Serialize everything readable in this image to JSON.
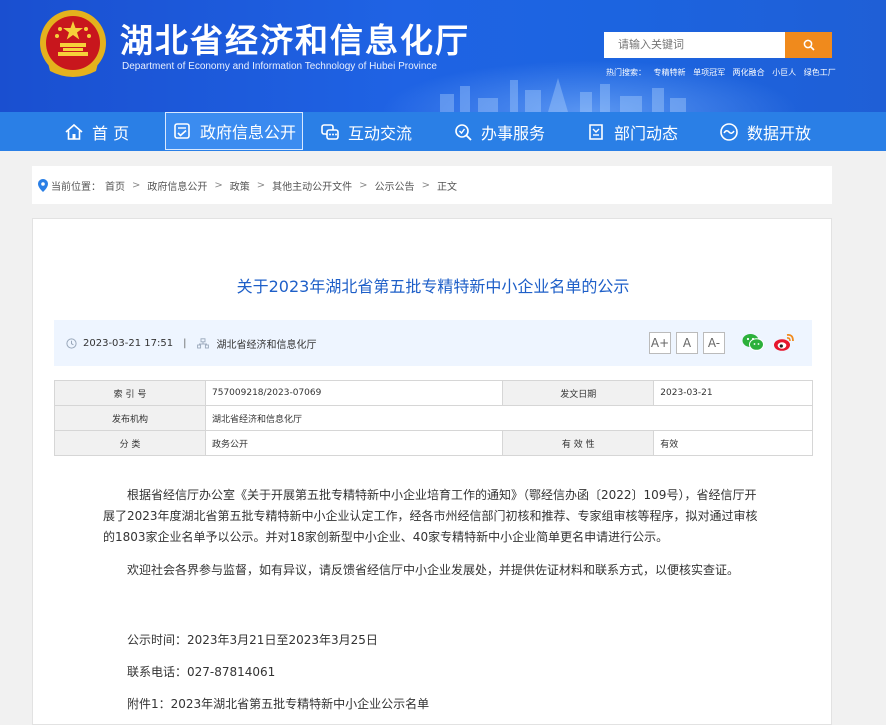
{
  "header": {
    "title": "湖北省经济和信息化厅",
    "subtitle": "Department of Economy and Information Technology of Hubei Province",
    "search_placeholder": "请输入关键词",
    "hot_label": "热门搜索：",
    "hot_links": [
      "专精特新",
      "单项冠军",
      "两化融合",
      "小巨人",
      "绿色工厂"
    ]
  },
  "nav": {
    "items": [
      {
        "label": "首 页",
        "icon": "home-icon"
      },
      {
        "label": "政府信息公开",
        "icon": "document-check-icon"
      },
      {
        "label": "互动交流",
        "icon": "chat-icon"
      },
      {
        "label": "办事服务",
        "icon": "search-service-icon"
      },
      {
        "label": "部门动态",
        "icon": "news-icon"
      },
      {
        "label": "数据开放",
        "icon": "data-wave-icon"
      }
    ],
    "active_index": 1
  },
  "breadcrumb": {
    "label": "当前位置：",
    "items": [
      "首页",
      "政府信息公开",
      "政策",
      "其他主动公开文件",
      "公示公告",
      "正文"
    ]
  },
  "article": {
    "title": "关于2023年湖北省第五批专精特新中小企业名单的公示",
    "datetime": "2023-03-21 17:51",
    "publisher": "湖北省经济和信息化厅",
    "font_buttons": [
      "A+",
      "A",
      "A-"
    ],
    "share_icons": [
      "wechat-icon",
      "weibo-icon"
    ],
    "info_table": {
      "index_label": "索 引 号",
      "index_value": "757009218/2023-07069",
      "date_label": "发文日期",
      "date_value": "2023-03-21",
      "issuer_label": "发布机构",
      "issuer_value": "湖北省经济和信息化厅",
      "category_label": "分 类",
      "category_value": "政务公开",
      "validity_label": "有 效 性",
      "validity_value": "有效"
    },
    "paragraphs": [
      "根据省经信厅办公室《关于开展第五批专精特新中小企业培育工作的通知》（鄂经信办函〔2022〕109号），省经信厅开展了2023年度湖北省第五批专精特新中小企业认定工作，经各市州经信部门初核和推荐、专家组审核等程序，拟对通过审核的1803家企业名单予以公示。并对18家创新型中小企业、40家专精特新中小企业简单更名申请进行公示。",
      "欢迎社会各界参与监督，如有异议，请反馈省经信厅中小企业发展处，并提供佐证材料和联系方式，以便核实查证。"
    ],
    "notice_period": "公示时间：2023年3月21日至2023年3月25日",
    "phone": "联系电话：027-87814061",
    "attachment": "附件1：2023年湖北省第五批专精特新中小企业公示名单"
  }
}
